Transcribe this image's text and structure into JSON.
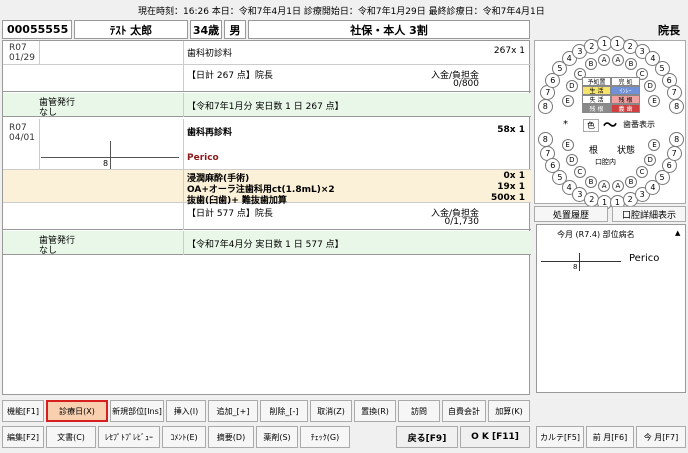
{
  "top_status": "現在時刻：16:26  本日：令和7年4月1日   診療開始日：令和7年1月29日   最終診療日：令和7年4月1日",
  "patient": {
    "id": "00055555",
    "name": "ﾃｽﾄ 太郎",
    "age": "34歳",
    "sex": "男",
    "insurance": "社保・本人 3割",
    "doctor": "院長"
  },
  "records": [
    {
      "date_era": "R07",
      "date_md": "01/29",
      "procedure": "歯科初診料",
      "points": "267x 1",
      "total": "【日計 267 点】院長",
      "payment_label": "入金/負担金",
      "payment_value": "0/800",
      "issue_label": "歯管発行",
      "issue_value": "なし",
      "summary": "【令和7年1月分 実日数 1 日 267 点】"
    },
    {
      "date_era": "R07",
      "date_md": "04/01",
      "procedure": "歯科再診料",
      "points": "58x 1",
      "tooth_num": "8",
      "diagnosis": "Perico",
      "items": [
        {
          "name": "浸潤麻酔(手術)",
          "points": "0x 1"
        },
        {
          "name": "OA+オーラ注歯科用ct(1.8mL)×2",
          "points": "19x 1"
        },
        {
          "name": "抜歯(臼歯)+ 難抜歯加算",
          "points": "500x 1"
        }
      ],
      "total": "【日計 577 点】院長",
      "payment_label": "入金/負担金",
      "payment_value": "0/1,730",
      "issue_label": "歯管発行",
      "issue_value": "なし",
      "summary": "【令和7年4月分 実日数 1 日 577 点】"
    }
  ],
  "dental_chart": {
    "upper_left": [
      "8",
      "7",
      "6",
      "5",
      "4",
      "3",
      "2",
      "1"
    ],
    "upper_right": [
      "1",
      "2",
      "3",
      "4",
      "5",
      "6",
      "7",
      "8"
    ],
    "deciduous_upper_left": [
      "E",
      "D",
      "C",
      "B",
      "A"
    ],
    "deciduous_upper_right": [
      "A",
      "B",
      "C",
      "D",
      "E"
    ],
    "lower_left": [
      "8",
      "7",
      "6",
      "5",
      "4",
      "3",
      "2",
      "1"
    ],
    "lower_right": [
      "1",
      "2",
      "3",
      "4",
      "5",
      "6",
      "7",
      "8"
    ],
    "deciduous_lower_left": [
      "E",
      "D",
      "C",
      "B",
      "A"
    ],
    "deciduous_lower_right": [
      "A",
      "B",
      "C",
      "D",
      "E"
    ],
    "legend": [
      {
        "label": "予処置",
        "color": "#ffffff"
      },
      {
        "label": "完 処",
        "color": "#ffffff"
      },
      {
        "label": "生 活",
        "color": "#f5e36b"
      },
      {
        "label": "ｲﾝﾚｰ",
        "color": "#7090d8"
      },
      {
        "label": "失 活",
        "color": "#ffffff"
      },
      {
        "label": "残 根",
        "color": "#f0a0a0"
      },
      {
        "label": "残 根",
        "color": "#8a8a8a"
      },
      {
        "label": "義 歯",
        "color": "#d04040"
      }
    ],
    "star": "*",
    "color_label": "色",
    "tilde": "〜",
    "display_label": "歯番表示",
    "root_label": "根",
    "state_label": "状態",
    "oral_label": "口腔内",
    "history_btn": "処置履歴",
    "detail_btn": "口腔詳細表示"
  },
  "right_panel": {
    "title": "今月 (R7.4) 部位病名",
    "tooth": "8",
    "diagnosis": "Perico"
  },
  "buttons_row1": [
    "機能[F1]",
    "診療日(X)",
    "新規部位[Ins]",
    "挿入(I)",
    "追加_[+]",
    "削除_[-]",
    "取消(Z)",
    "置換(R)",
    "訪問",
    "自費会計",
    "加算(K)"
  ],
  "buttons_row2": [
    "編集[F2]",
    "文書(C)",
    "ﾚｾﾌﾟﾄﾌﾟﾚﾋﾞｭｰ",
    "ｺﾒﾝﾄ(E)",
    "摘要(D)",
    "薬剤(S)",
    "ﾁｪｯｸ(G)",
    "戻る[F9]",
    "O K [F11]"
  ],
  "buttons_right": [
    "カルテ[F5]",
    "前 月[F6]",
    "今 月[F7]"
  ],
  "highlight_color": "#d62020"
}
